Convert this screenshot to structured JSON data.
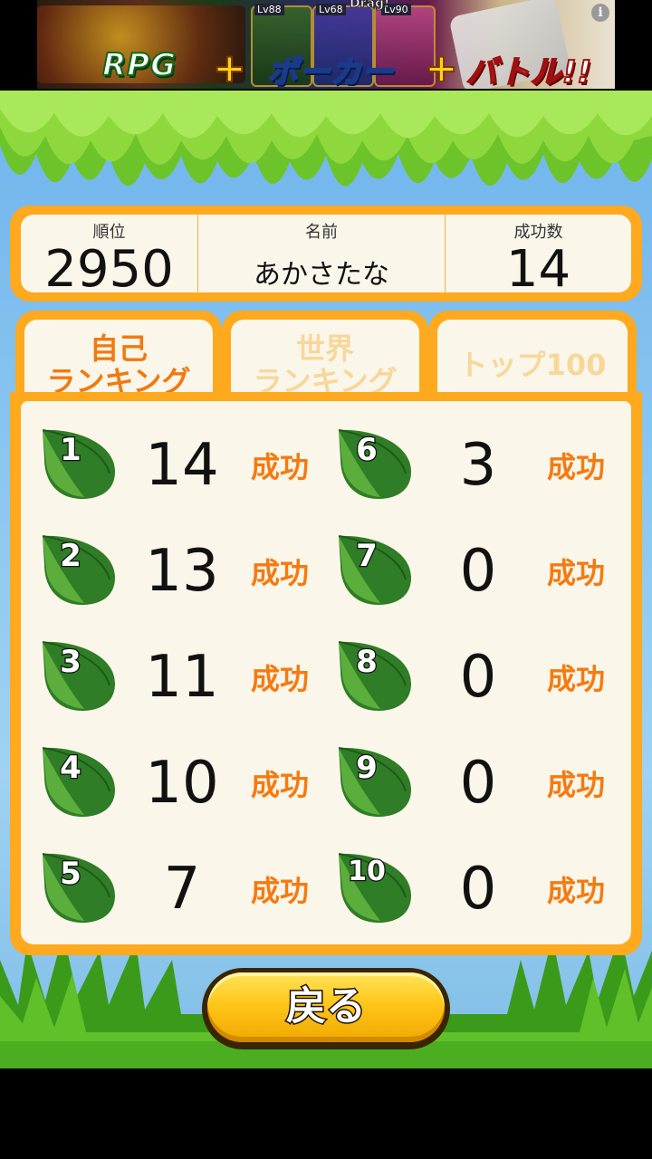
{
  "ad": {
    "text_rpg": "RPG",
    "text_poker": "ポーカー",
    "text_battle": "バトル!!",
    "plus": "+",
    "lv_a": "Lv88",
    "lv_b": "Lv68",
    "lv_c": "Lv90",
    "drag": "Drag!",
    "info_icon": "i"
  },
  "summary": {
    "rank_label": "順位",
    "rank_value": "2950",
    "name_label": "名前",
    "name_value": "あかさたな",
    "success_label": "成功数",
    "success_value": "14"
  },
  "tabs": [
    {
      "label": "自己\nランキング",
      "state": "active"
    },
    {
      "label": "世界\nランキング",
      "state": "inactive"
    },
    {
      "label": "トップ100",
      "state": "inactive"
    }
  ],
  "ranking": {
    "suffix": "成功",
    "rows": [
      {
        "rank": "1",
        "count": "14"
      },
      {
        "rank": "2",
        "count": "13"
      },
      {
        "rank": "3",
        "count": "11"
      },
      {
        "rank": "4",
        "count": "10"
      },
      {
        "rank": "5",
        "count": "7"
      },
      {
        "rank": "6",
        "count": "3"
      },
      {
        "rank": "7",
        "count": "0"
      },
      {
        "rank": "8",
        "count": "0"
      },
      {
        "rank": "9",
        "count": "0"
      },
      {
        "rank": "10",
        "count": "0"
      }
    ]
  },
  "back_button": {
    "label": "戻る"
  },
  "colors": {
    "panel_orange": "#ffa91e",
    "panel_cream": "#fbf6ea",
    "accent_text": "#f57a10",
    "leaf_green": "#2f7d26",
    "button_yellow": "#ffc61a"
  }
}
